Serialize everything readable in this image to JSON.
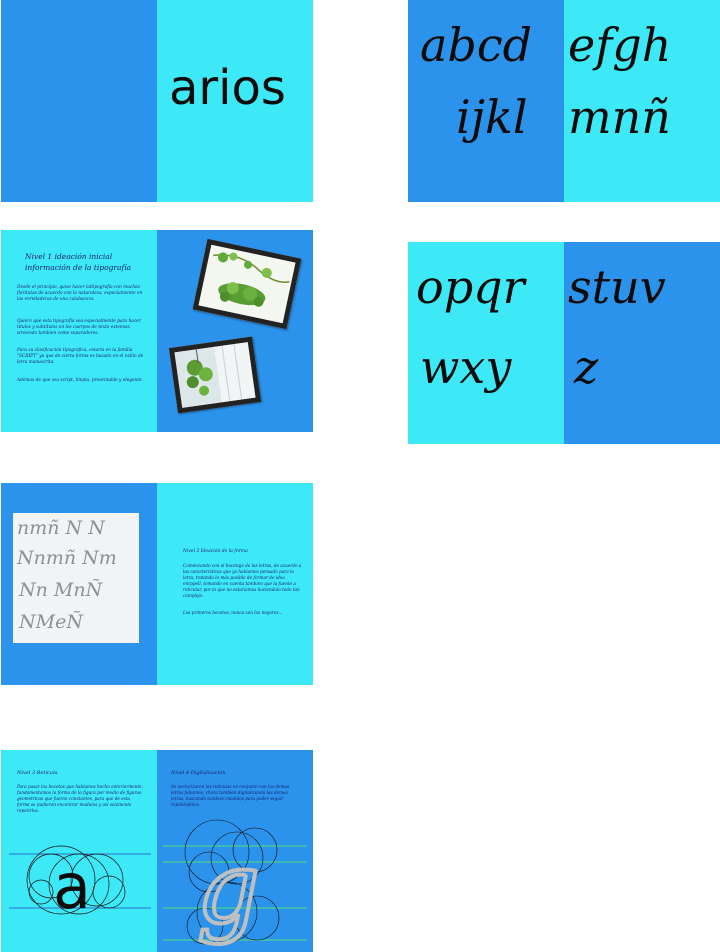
{
  "spread1": {
    "word": "arios"
  },
  "spread2": {
    "letters_left_top": "abcd",
    "letters_right_top": "efgh",
    "letters_left_bottom": "ijkl",
    "letters_right_bottom": "mnñ"
  },
  "spread3": {
    "heading_line1": "Nivel 1 ideación inicial",
    "heading_line2": "información de la tipografía",
    "para1": "Desde el principio, quise hacer laitipografía con muchas floritutas de acuerdo con la naturaleza, especialmente en las enredaderas de una calabacera.",
    "para2": "Quiero que esta tipografía sea especialmente para hacer títulos y subtítulos en los cuerpos de texto extensos, sirviendo tambien como separadores.",
    "para3": "Para su clasificación tipográfica, estaría en la familia \"SCRIPT\" ya que de cierta forma es basado en el estilo de letra manuscrita.",
    "para4": "Ademas de que sea script, limpia, presentable y elegante."
  },
  "spread4": {
    "letters_left_top": "opqr",
    "letters_right_top": "stuv",
    "letters_left_bottom": "wxy",
    "letters_right_bottom": "z"
  },
  "spread5": {
    "sketch_lines": [
      "nmñ N N",
      "Nnmñ Nm",
      "Nn MnÑ",
      "NMeÑ"
    ],
    "heading": "Nivel 2 Ideación de la forma",
    "para1": "Comenzando con el bocetaje de las letras, de acuerdo a las características que ya habíamos pensado para la letra, tratando lo más posible de formar de idea enrppell, tomando en cuenta tambien que la fuente a reticular, por lo que no estaríamos haciendolo todo tan complejo.",
    "para2": "Los primeros bocetos, nunca son los mejores..."
  },
  "spread6": {
    "left_heading": "Nivel 3 Retícula",
    "left_para": "Para pasar los bocetos que habíamos hecho anteriormente, fundamentamos la forma de la figura por medio de figuras geometricas que fueron constantes, para que de esta forma se pudieran encontrar modulos y así solamente repetirlos.",
    "left_glyph": "a",
    "right_heading": "Nivel 4 Digitalización",
    "right_para": "Se vectorizaron las retículas en conjunto con las demas letras faltantes, chora tambien digitalizando las demas letras, buscando tambien modulos para poder seguir repitiéndolos.",
    "right_glyph": "g"
  },
  "colors": {
    "blue": "#2b93ec",
    "cyan": "#3ee9f7",
    "ink": "#0b0b0b",
    "text_blue": "#1a2070"
  }
}
